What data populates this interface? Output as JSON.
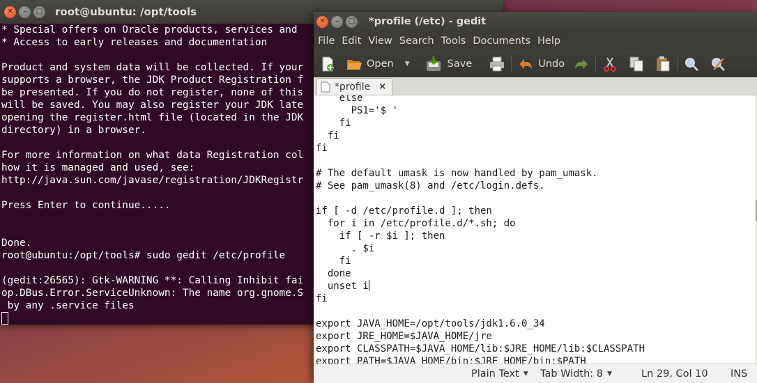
{
  "terminal": {
    "title": "root@ubuntu: /opt/tools",
    "lines": [
      "* Special offers on Oracle products, services and",
      "* Access to early releases and documentation",
      "",
      "Product and system data will be collected. If your",
      "supports a browser, the JDK Product Registration f",
      "be presented. If you do not register, none of this",
      "will be saved. You may also register your JDK late",
      "opening the register.html file (located in the JDK",
      "directory) in a browser.",
      "",
      "For more information on what data Registration col",
      "how it is managed and used, see:",
      "http://java.sun.com/javase/registration/JDKRegistr",
      "",
      "Press Enter to continue.....",
      "",
      "",
      "Done.",
      "root@ubuntu:/opt/tools# sudo gedit /etc/profile",
      "",
      "(gedit:26565): Gtk-WARNING **: Calling Inhibit fai",
      "op.DBus.Error.ServiceUnknown: The name org.gnome.S",
      " by any .service files"
    ]
  },
  "gedit": {
    "title": "*profile (/etc) - gedit",
    "menu": [
      "File",
      "Edit",
      "View",
      "Search",
      "Tools",
      "Documents",
      "Help"
    ],
    "toolbar": {
      "open_label": "Open",
      "save_label": "Save",
      "undo_label": "Undo"
    },
    "tab": {
      "label": "*profile",
      "close": "×"
    },
    "code_lines": [
      "    else",
      "      PS1='$ '",
      "    fi",
      "  fi",
      "fi",
      "",
      "# The default umask is now handled by pam_umask.",
      "# See pam_umask(8) and /etc/login.defs.",
      "",
      "if [ -d /etc/profile.d ]; then",
      "  for i in /etc/profile.d/*.sh; do",
      "    if [ -r $i ]; then",
      "      . $i",
      "    fi",
      "  done",
      "  unset i",
      "fi",
      "",
      "export JAVA_HOME=/opt/tools/jdk1.6.0_34",
      "export JRE_HOME=$JAVA_HOME/jre",
      "export CLASSPATH=$JAVA_HOME/lib:$JRE_HOME/lib:$CLASSPATH",
      "export PATH=$JAVA_HOME/bin:$JRE_HOME/bin:$PATH"
    ],
    "cursor_line_index": 15,
    "status": {
      "language": "Plain Text",
      "tab_width": "Tab Width: 8",
      "position": "Ln 29, Col 10",
      "mode": "INS"
    }
  }
}
